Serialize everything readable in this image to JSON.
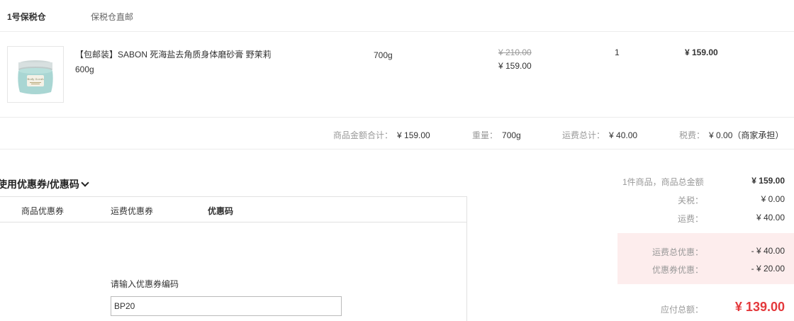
{
  "warehouse": {
    "name": "1号保税仓",
    "shipping_type": "保税仓直邮"
  },
  "product": {
    "name": "【包邮装】SABON 死海盐去角质身体磨砂膏 野茉莉 600g",
    "spec": "700g",
    "original_price": "¥ 210.00",
    "price": "¥ 159.00",
    "quantity": "1",
    "subtotal": "¥ 159.00",
    "image_label": "Body Scrub"
  },
  "summary": {
    "goods_total_label": "商品金额合计：",
    "goods_total": "¥ 159.00",
    "weight_label": "重量：",
    "weight": "700g",
    "freight_label": "运费总计：",
    "freight": "¥ 40.00",
    "tax_label": "税费：",
    "tax": "¥ 0.00（商家承担）"
  },
  "coupon": {
    "toggle_label": "使用优惠券/优惠码",
    "tabs": [
      {
        "label": "商品优惠券"
      },
      {
        "label": "运费优惠券"
      },
      {
        "label": "优惠码"
      }
    ],
    "code_label": "请输入优惠券编码",
    "code_value": "BP20"
  },
  "totals": {
    "goods_label": "1件商品，商品总金额",
    "goods_value": "¥ 159.00",
    "duty_label": "关税：",
    "duty_value": "¥ 0.00",
    "freight_label": "运费：",
    "freight_value": "¥ 40.00",
    "freight_discount_label": "运费总优惠：",
    "freight_discount_value": "- ¥ 40.00",
    "coupon_discount_label": "优惠券优惠：",
    "coupon_discount_value": "- ¥ 20.00",
    "pay_label": "应付总额：",
    "pay_value": "¥ 139.00"
  },
  "colors": {
    "accent": "#e4393c",
    "discount_bg": "#fdeded"
  }
}
